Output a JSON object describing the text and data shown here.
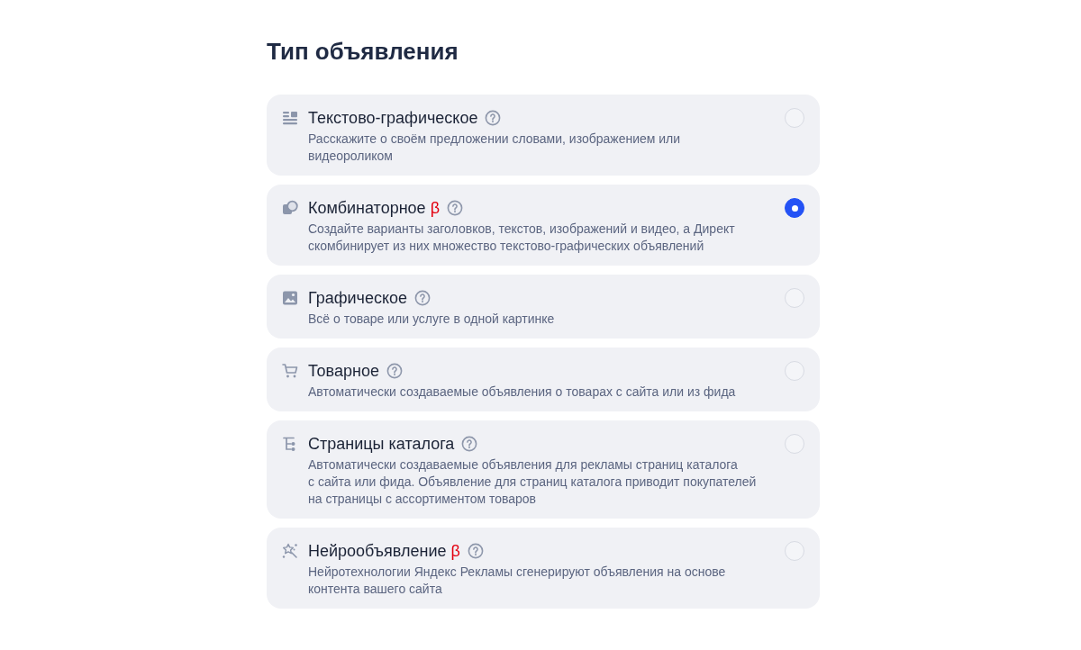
{
  "heading": "Тип объявления",
  "options": [
    {
      "title": "Текстово-графическое",
      "description": "Расскажите о своём предложении словами, изображением или\nвидеороликом",
      "selected": false
    },
    {
      "title": "Комбинаторное",
      "badge": "β",
      "description": "Создайте варианты заголовков, текстов, изображений и видео, а Директ\nскомбинирует из них множество текстово-графических объявлений",
      "selected": true
    },
    {
      "title": "Графическое",
      "description": "Всё о товаре или услуге в одной картинке",
      "selected": false
    },
    {
      "title": "Товарное",
      "description": "Автоматически создаваемые объявления о товарах с сайта или из фида",
      "selected": false
    },
    {
      "title": "Страницы каталога",
      "description": "Автоматически создаваемые объявления для рекламы страниц каталога\nс сайта или фида. Объявление для страниц каталога приводит покупателей\nна страницы с ассортиментом товаров",
      "selected": false
    },
    {
      "title": "Нейрообъявление",
      "badge": "β",
      "description": "Нейротехнологии Яндекс Рекламы сгенерируют объявления на основе\nконтента вашего сайта",
      "selected": false
    }
  ]
}
